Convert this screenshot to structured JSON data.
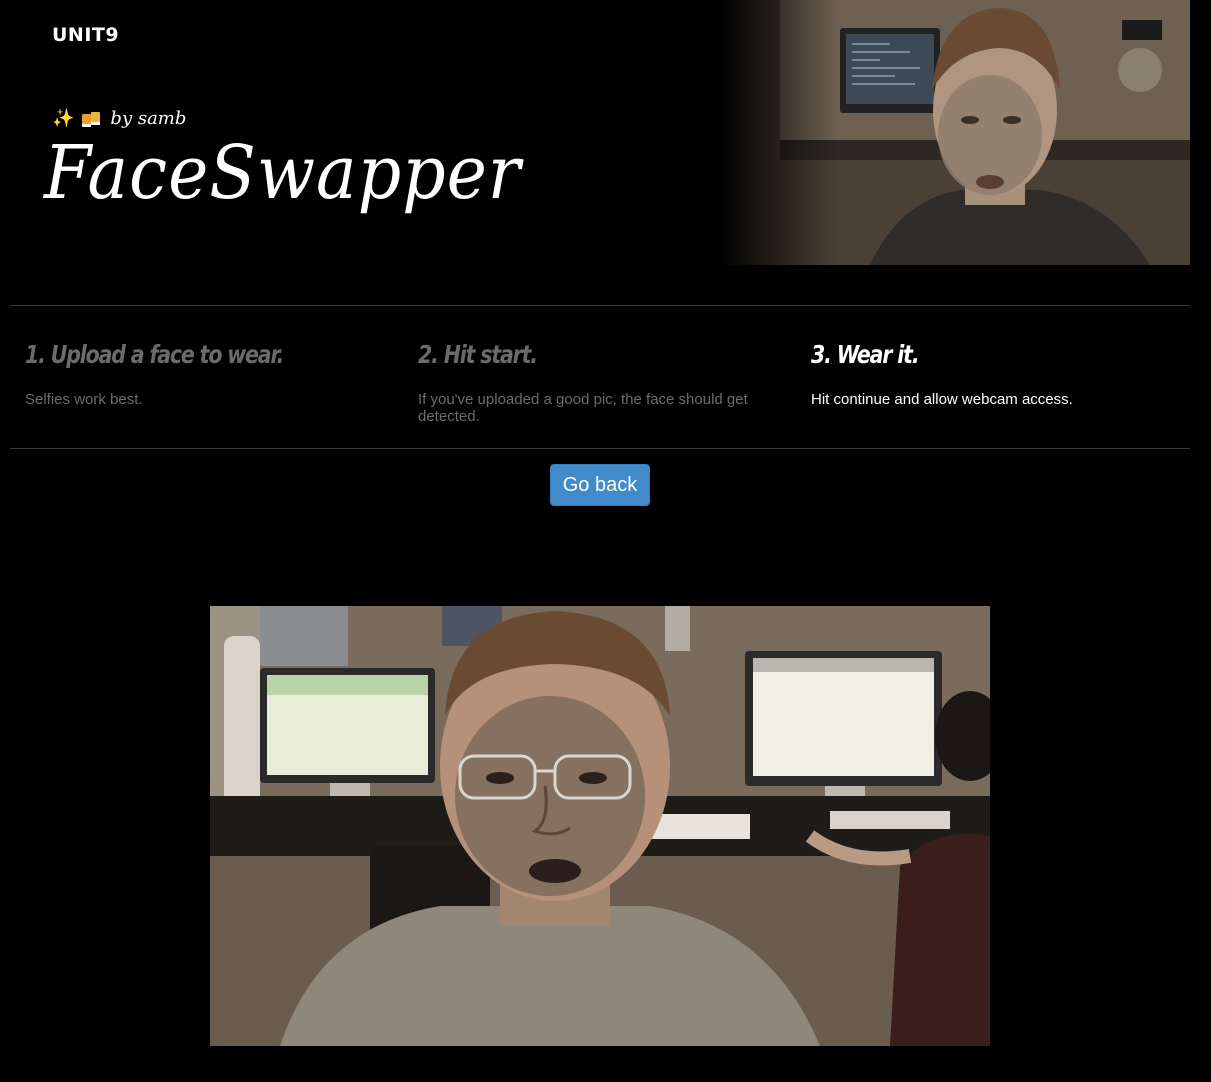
{
  "header": {
    "logo": "UNIT9",
    "byline_emoji_sparkles": "✨",
    "byline_text": "by samb",
    "title": "FaceSwapper"
  },
  "steps": [
    {
      "title": "1. Upload a face to wear.",
      "description": "Selfies work best.",
      "state": "inactive"
    },
    {
      "title": "2. Hit start.",
      "description": "If you've uploaded a good pic, the face should get detected.",
      "state": "inactive"
    },
    {
      "title": "3. Wear it.",
      "description": "Hit continue and allow webcam access.",
      "state": "active"
    }
  ],
  "actions": {
    "go_back_label": "Go back"
  },
  "colors": {
    "background": "#000000",
    "button": "#428bca",
    "muted_text": "#6b6b6b",
    "divider": "#3a3a3a"
  }
}
